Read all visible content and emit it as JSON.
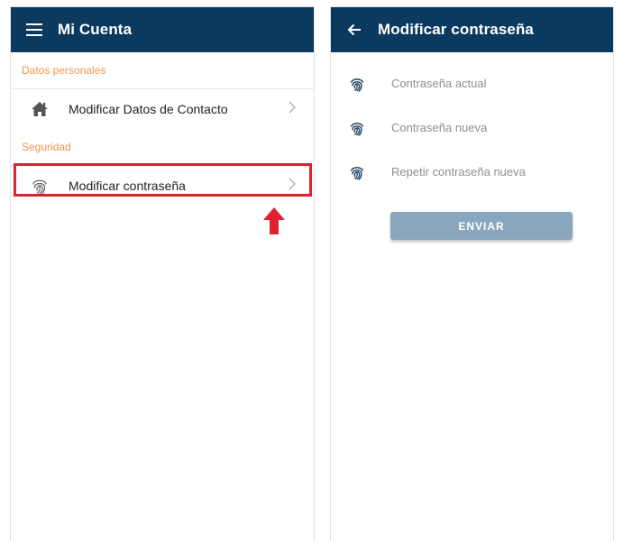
{
  "left": {
    "appbar": {
      "menu_icon": "hamburger-menu-icon",
      "title": "Mi Cuenta"
    },
    "sections": {
      "personal": {
        "header": "Datos personales",
        "item": {
          "icon": "home-icon",
          "label": "Modificar Datos de Contacto"
        }
      },
      "security": {
        "header": "Seguridad",
        "item": {
          "icon": "fingerprint-icon",
          "label": "Modificar contraseña"
        }
      }
    },
    "annotation": {
      "highlight_color": "#e0212e",
      "arrow_icon": "up-arrow-icon"
    }
  },
  "right": {
    "appbar": {
      "back_icon": "arrow-back-icon",
      "title": "Modificar contraseña"
    },
    "fields": [
      {
        "icon": "fingerprint-icon",
        "placeholder": "Contraseña actual"
      },
      {
        "icon": "fingerprint-icon",
        "placeholder": "Contraseña nueva"
      },
      {
        "icon": "fingerprint-icon",
        "placeholder": "Repetir contraseña nueva"
      }
    ],
    "submit_label": "ENVIAR"
  },
  "colors": {
    "appbar": "#0c3a5e",
    "section_header": "#f0964a",
    "button_disabled": "#8aa6bd",
    "highlight": "#e0212e"
  }
}
